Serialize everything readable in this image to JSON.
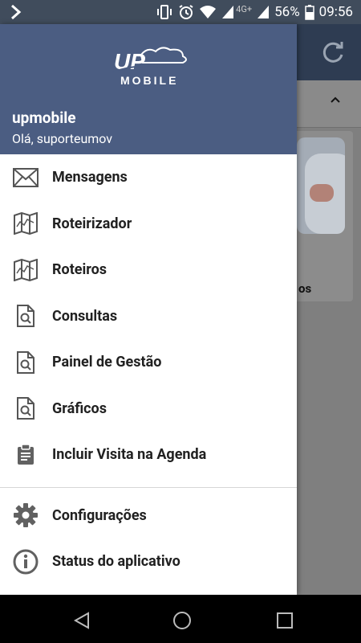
{
  "status_bar": {
    "network_label": "4G+",
    "battery_percent": "56%",
    "time": "09:56"
  },
  "app": {
    "card_label_partial": "os"
  },
  "drawer": {
    "logo_text_top": "UP",
    "logo_text_bottom": "MOBILE",
    "username": "upmobile",
    "greeting": "Olá, suporteumov",
    "items": [
      {
        "label": "Mensagens",
        "icon": "mail-icon"
      },
      {
        "label": "Roteirizador",
        "icon": "map-icon"
      },
      {
        "label": "Roteiros",
        "icon": "map-icon"
      },
      {
        "label": "Consultas",
        "icon": "document-search-icon"
      },
      {
        "label": "Painel de Gestão",
        "icon": "document-search-icon"
      },
      {
        "label": "Gráficos",
        "icon": "document-search-icon"
      },
      {
        "label": "Incluir Visita na Agenda",
        "icon": "clipboard-icon"
      }
    ],
    "secondary_items": [
      {
        "label": "Configurações",
        "icon": "gear-icon"
      },
      {
        "label": "Status do aplicativo",
        "icon": "info-icon"
      }
    ]
  },
  "colors": {
    "header_bg": "#4b5d82",
    "toolbar_bg": "#2e3c52",
    "status_bg": "#404c5c"
  }
}
